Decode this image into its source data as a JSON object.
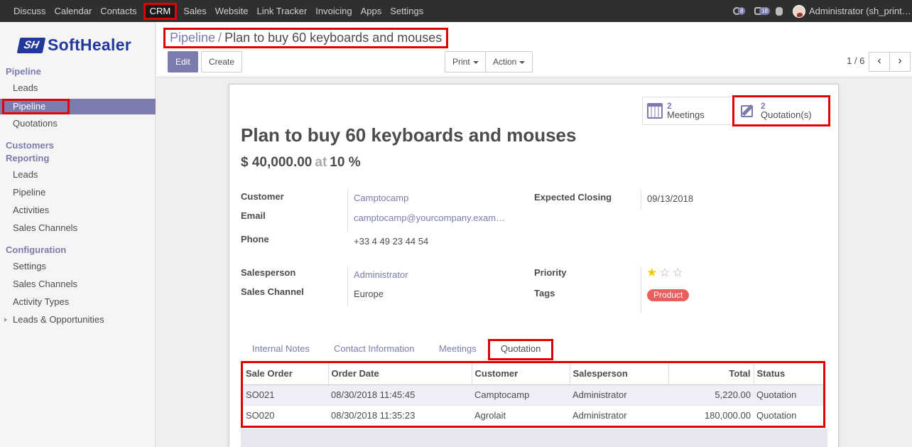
{
  "topbar": {
    "menu": [
      "Discuss",
      "Calendar",
      "Contacts",
      "CRM",
      "Sales",
      "Website",
      "Link Tracker",
      "Invoicing",
      "Apps",
      "Settings"
    ],
    "badges": {
      "activities": "8",
      "messages": "18"
    },
    "user": "Administrator (sh_print…"
  },
  "sidebar": {
    "logo_mark": "SH",
    "logo_text": "SoftHealer",
    "sections": [
      {
        "title": "Pipeline",
        "items": [
          "Leads",
          "Pipeline",
          "Quotations"
        ]
      },
      {
        "title": "Customers",
        "items": []
      },
      {
        "title": "Reporting",
        "items": [
          "Leads",
          "Pipeline",
          "Activities",
          "Sales Channels"
        ]
      },
      {
        "title": "Configuration",
        "items": [
          "Settings",
          "Sales Channels",
          "Activity Types",
          "Leads & Opportunities"
        ]
      }
    ]
  },
  "control_panel": {
    "breadcrumb_parent": "Pipeline",
    "breadcrumb_sep": "/",
    "breadcrumb_current": "Plan to buy 60 keyboards and mouses",
    "edit": "Edit",
    "create": "Create",
    "print": "Print",
    "action": "Action",
    "pager": "1 / 6",
    "prev": "‹",
    "next": "›"
  },
  "record": {
    "smart_buttons": {
      "meetings": {
        "count": "2",
        "label": "Meetings"
      },
      "quotations": {
        "count": "2",
        "label": "Quotation(s)"
      }
    },
    "title": "Plan to buy 60 keyboards and mouses",
    "revenue": "$ 40,000.00",
    "at": "at",
    "probability": "10 %",
    "fields": {
      "customer_label": "Customer",
      "customer": "Camptocamp",
      "email_label": "Email",
      "email": "camptocamp@yourcompany.exam…",
      "phone_label": "Phone",
      "phone": "+33 4 49 23 44 54",
      "expected_closing_label": "Expected Closing",
      "expected_closing": "09/13/2018",
      "salesperson_label": "Salesperson",
      "salesperson": "Administrator",
      "sales_channel_label": "Sales Channel",
      "sales_channel": "Europe",
      "priority_label": "Priority",
      "priority": 1,
      "tags_label": "Tags",
      "tag": "Product"
    },
    "tabs": [
      "Internal Notes",
      "Contact Information",
      "Meetings",
      "Quotation"
    ],
    "table": {
      "headers": [
        "Sale Order",
        "Order Date",
        "Customer",
        "Salesperson",
        "Total",
        "Status"
      ],
      "rows": [
        [
          "SO021",
          "08/30/2018 11:45:45",
          "Camptocamp",
          "Administrator",
          "5,220.00",
          "Quotation"
        ],
        [
          "SO020",
          "08/30/2018 11:35:23",
          "Agrolait",
          "Administrator",
          "180,000.00",
          "Quotation"
        ]
      ]
    }
  }
}
